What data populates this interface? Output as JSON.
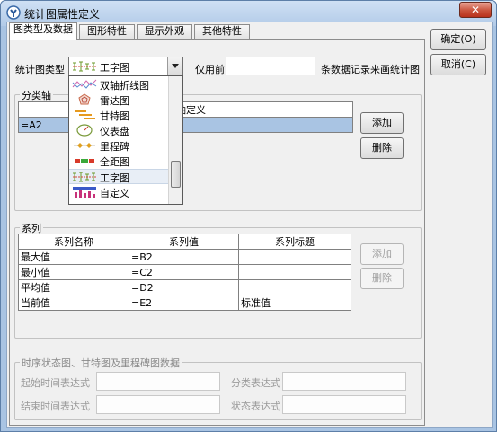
{
  "window": {
    "title": "统计图属性定义",
    "close_symbol": "✕"
  },
  "tabs": [
    {
      "label": "图类型及数据",
      "active": true
    },
    {
      "label": "图形特性",
      "active": false
    },
    {
      "label": "显示外观",
      "active": false
    },
    {
      "label": "其他特性",
      "active": false
    }
  ],
  "actions": {
    "ok_label": "确定(O)",
    "cancel_label": "取消(C)"
  },
  "chart_type": {
    "label": "统计图类型",
    "value": "工字图",
    "use_first_label": "仅用前",
    "use_first_value": "",
    "suffix_label": "条数据记录来画统计图"
  },
  "dropdown": {
    "options": [
      {
        "label": "双轴折线图",
        "icon": "dual-axis-line-icon"
      },
      {
        "label": "雷达图",
        "icon": "radar-chart-icon"
      },
      {
        "label": "甘特图",
        "icon": "gantt-chart-icon"
      },
      {
        "label": "仪表盘",
        "icon": "gauge-icon"
      },
      {
        "label": "里程碑",
        "icon": "milestone-icon"
      },
      {
        "label": "全距图",
        "icon": "range-chart-icon"
      },
      {
        "label": "工字图",
        "icon": "i-beam-chart-icon",
        "selected": true
      },
      {
        "label": "自定义",
        "icon": "custom-chart-icon"
      }
    ]
  },
  "category_axis": {
    "title": "分类轴",
    "column_header": "轴定义",
    "rows": [
      {
        "value": "=A2",
        "selected": true
      }
    ],
    "add_label": "添加",
    "delete_label": "删除"
  },
  "series": {
    "title": "系列",
    "headers": [
      "系列名称",
      "系列值",
      "系列标题"
    ],
    "rows": [
      [
        "最大值",
        "=B2",
        ""
      ],
      [
        "最小值",
        "=C2",
        ""
      ],
      [
        "平均值",
        "=D2",
        ""
      ],
      [
        "当前值",
        "=E2",
        "标准值"
      ]
    ],
    "add_label": "添加",
    "delete_label": "删除"
  },
  "timing": {
    "title": "时序状态图、甘特图及里程碑图数据",
    "start_label": "起始时间表达式",
    "end_label": "结束时间表达式",
    "category_label": "分类表达式",
    "state_label": "状态表达式",
    "start_value": "",
    "end_value": "",
    "category_value": "",
    "state_value": ""
  },
  "colors": {
    "selection": "#a9c4e3",
    "window_frame": "#a9c4e3",
    "close_button": "#c9523b"
  }
}
